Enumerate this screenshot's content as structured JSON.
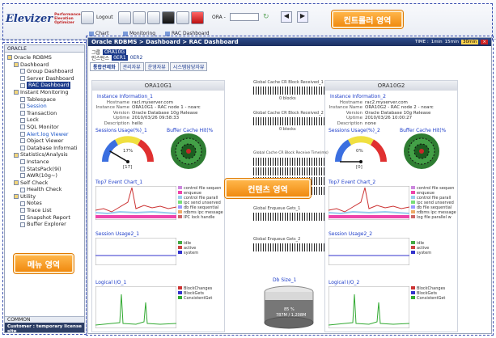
{
  "toolbar": {
    "logo_text": "Elevizer",
    "logo_tagline": "Performance Elevation Optimizer",
    "logout_label": "Logout",
    "ora_label": "ORA -",
    "menu_items": [
      {
        "label": "Chart",
        "icon": "chart-icon"
      },
      {
        "label": "Monitoring",
        "icon": "monitor-icon"
      },
      {
        "label": "RAC Dashboard",
        "icon": "dashboard-icon"
      }
    ]
  },
  "callouts": {
    "controller": "컨트롤러 영역",
    "contents": "컨텐츠 영역",
    "menu": "메뉴 영역"
  },
  "sidebar": {
    "header": "ORACLE",
    "items": [
      {
        "label": "Oracle RDBMS",
        "depth": 0
      },
      {
        "label": "Dashboard",
        "depth": 1
      },
      {
        "label": "Group Dashboard",
        "depth": 2
      },
      {
        "label": "Server Dashboard",
        "depth": 2
      },
      {
        "label": "RAC Dashboard",
        "depth": 2,
        "selected": true
      },
      {
        "label": "Instant Monitoring",
        "depth": 1
      },
      {
        "label": "Tablespace",
        "depth": 2
      },
      {
        "label": "Session",
        "depth": 2,
        "blue": true
      },
      {
        "label": "Transaction",
        "depth": 2
      },
      {
        "label": "Lock",
        "depth": 2
      },
      {
        "label": "SQL Monitor",
        "depth": 2
      },
      {
        "label": "Alert.log Viewer",
        "depth": 2,
        "blue": true
      },
      {
        "label": "Object Viewer",
        "depth": 2
      },
      {
        "label": "Database Informati",
        "depth": 2
      },
      {
        "label": "Statistics/Analysis",
        "depth": 1
      },
      {
        "label": "Instance",
        "depth": 2
      },
      {
        "label": "StatsPack(9i)",
        "depth": 2
      },
      {
        "label": "AWR(10g~)",
        "depth": 2
      },
      {
        "label": "Self Check",
        "depth": 1
      },
      {
        "label": "Health Check",
        "depth": 2
      },
      {
        "label": "Utility",
        "depth": 1
      },
      {
        "label": "Notes",
        "depth": 2
      },
      {
        "label": "Trace List",
        "depth": 2
      },
      {
        "label": "Snapshot Report",
        "depth": 2
      },
      {
        "label": "Buffer Explorer",
        "depth": 2
      }
    ],
    "footer_label": "COMMON",
    "customer_label": "Customer : temporary license site"
  },
  "main": {
    "breadcrumb": "Oracle RDBMS > Dashboard > RAC Dashboard",
    "time_label": "TIME :",
    "time_options": [
      "1min",
      "15min",
      "30min"
    ],
    "time_selected": "30min",
    "group_label": "그룹",
    "group_value": "ORA10G",
    "instance_label": "인스턴스",
    "instance_values": [
      "0ER1",
      "0ER2"
    ],
    "tabs": [
      "통합관제화",
      "관리자뷰",
      "운영자뷰",
      "시스템담당자뷰"
    ],
    "active_tab": "통합관제화"
  },
  "panels": [
    {
      "name": "ORA10G1",
      "info_title": "Instance Information_1",
      "info": [
        {
          "k": "Hostname",
          "v": "racl.myserver.com"
        },
        {
          "k": "Instance Name",
          "v": "ORA10G1 - RAC node 1 - noarc"
        },
        {
          "k": "Version",
          "v": "Oracle Database 10g Release"
        },
        {
          "k": "Uptime",
          "v": "2010/03/26 09:58:33"
        },
        {
          "k": "Description",
          "v": "hello"
        }
      ],
      "sessions_title": "Sessions Usage(%)_1",
      "sessions_pct": "17%",
      "sessions_count": "[17]",
      "buffer_title": "Buffer Cache Hit(%",
      "event_title": "Top7 Event Chart_1",
      "events": [
        "control file sequen",
        "enqueue",
        "control file parall",
        "ipc send unserved",
        "db file sequential",
        "rdbms ipc message",
        "IPC lock handle"
      ],
      "session_usage_title": "Session Usage2_1",
      "session_legend": [
        "idle",
        "active",
        "system"
      ],
      "io_title": "Logical I/O_1",
      "io_legend": [
        "BlockChanges",
        "BlockGets",
        "ConsistentGet"
      ]
    },
    {
      "name": "ORA10G2",
      "info_title": "Instance Information_2",
      "info": [
        {
          "k": "Hostname",
          "v": "rac2.myserver.com"
        },
        {
          "k": "Instance Name",
          "v": "ORA10G2 - RAC node 2 - noarc"
        },
        {
          "k": "Version",
          "v": "Oracle Database 10g Release"
        },
        {
          "k": "Uptime",
          "v": "2010/03/26 10:00:27"
        },
        {
          "k": "Description",
          "v": "none"
        }
      ],
      "sessions_title": "Sessions Usage(%)_2",
      "sessions_pct": "0%",
      "sessions_count": "[0]",
      "buffer_title": "Buffer Cache Hit(%",
      "event_title": "Top7 Event Chart_2",
      "events": [
        "control file sequen",
        "enqueue",
        "control file parall",
        "ipc send unserved",
        "db file sequential",
        "rdbms ipc message",
        "log file parallel w"
      ],
      "session_usage_title": "Session Usage2_2",
      "session_legend": [
        "idle",
        "active",
        "system"
      ],
      "io_title": "Logical I/O_2",
      "io_legend": [
        "BlockChanges",
        "BlockGets",
        "ConsistentGet"
      ]
    }
  ],
  "middle": {
    "cr_block_1": "Global Cache CR Block Received_1",
    "cr_block_2": "Global Cache CR Block Received_2",
    "cr_receive_time": "Global Cache CR Block Receive Time(ms)",
    "enqueue_1": "Global Enqueue Gets_1",
    "enqueue_2": "Global Enqueue Gets_2",
    "zero_value": "0 blocks",
    "db_size_title": "Db Size_1",
    "db_size_pct": "85 %",
    "db_size_value": "787M / 1,208M"
  },
  "colors": {
    "callout": "#f08a10",
    "header": "#1d3c8c",
    "accent_link": "#1a3ac8",
    "frame": "#3a4fb0"
  }
}
